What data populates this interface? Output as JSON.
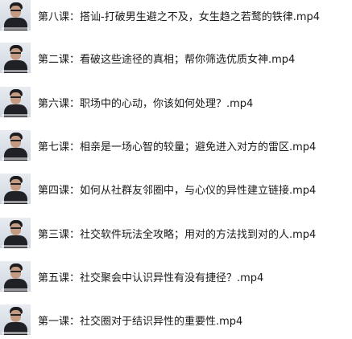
{
  "files": [
    {
      "title": "第八课：搭讪-打破男生避之不及，女生趋之若鹜的铁律.mp4",
      "icon": "video-thumbnail-icon"
    },
    {
      "title": "第二课：看破这些途径的真相；帮你筛选优质女神.mp4",
      "icon": "video-thumbnail-icon"
    },
    {
      "title": "第六课：职场中的心动，你该如何处理？.mp4",
      "icon": "video-thumbnail-icon"
    },
    {
      "title": "第七课：相亲是一场心智的较量；避免进入对方的雷区.mp4",
      "icon": "video-thumbnail-icon"
    },
    {
      "title": "第四课：如何从社群友邻圈中，与心仪的异性建立链接.mp4",
      "icon": "video-thumbnail-icon"
    },
    {
      "title": "第三课：社交软件玩法全攻略；用对的方法找到对的人.mp4",
      "icon": "video-thumbnail-icon"
    },
    {
      "title": "第五课：社交聚会中认识异性有没有捷径？.mp4",
      "icon": "video-thumbnail-icon"
    },
    {
      "title": "第一课：社交圈对于结识异性的重要性.mp4",
      "icon": "video-thumbnail-icon"
    }
  ]
}
